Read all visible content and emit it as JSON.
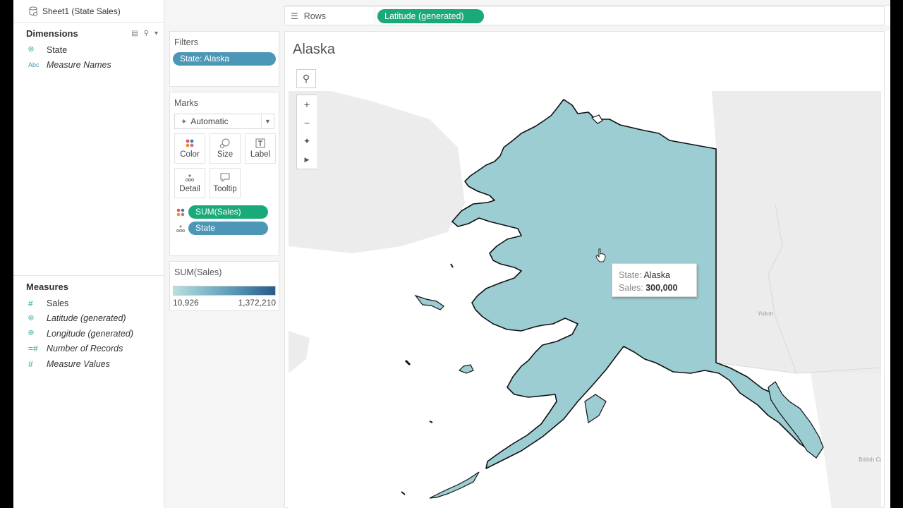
{
  "datasource": {
    "name": "Sheet1 (State Sales)"
  },
  "dimensions": {
    "title": "Dimensions",
    "fields": [
      {
        "icon": "globe-icon",
        "label": "State",
        "italic": false
      },
      {
        "icon": "abc-icon",
        "label": "Measure Names",
        "italic": true
      }
    ]
  },
  "measures": {
    "title": "Measures",
    "fields": [
      {
        "icon": "hash-icon",
        "label": "Sales"
      },
      {
        "icon": "globe-icon",
        "label": "Latitude (generated)"
      },
      {
        "icon": "globe-icon",
        "label": "Longitude (generated)"
      },
      {
        "icon": "hash-icon",
        "label": "Number of Records"
      },
      {
        "icon": "hash-icon",
        "label": "Measure Values"
      }
    ]
  },
  "filters": {
    "title": "Filters",
    "pill": "State: Alaska"
  },
  "marks": {
    "title": "Marks",
    "type": "Automatic",
    "buttons": {
      "color": "Color",
      "size": "Size",
      "label": "Label",
      "detail": "Detail",
      "tooltip": "Tooltip"
    },
    "pills": [
      "SUM(Sales)",
      "State"
    ]
  },
  "legend": {
    "title": "SUM(Sales)",
    "min": "10,926",
    "max": "1,372,210",
    "colors": [
      "#b8dfe0",
      "#2a5a86"
    ]
  },
  "rows": {
    "label": "Rows",
    "pill": "Latitude (generated)"
  },
  "view": {
    "title": "Alaska",
    "map_labels": {
      "yukon": "Yukon",
      "bc": "British Columbia"
    },
    "tooltip": {
      "state_key": "State:",
      "state_val": "Alaska",
      "sales_key": "Sales:",
      "sales_val": "300,000"
    }
  },
  "colors": {
    "state_fill": "#9ccdd3",
    "pill_blue": "#4c97b6",
    "pill_green": "#1aa979"
  }
}
